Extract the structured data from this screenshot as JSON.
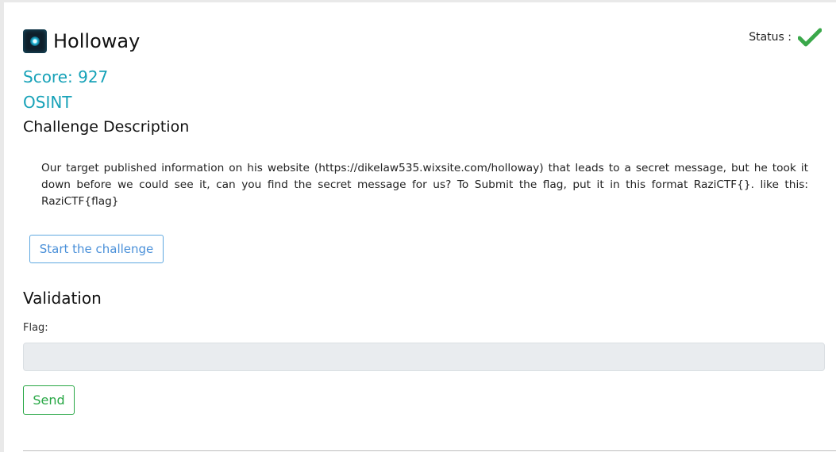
{
  "challenge": {
    "title": "Holloway",
    "logo_icon": "cyber-eye-icon",
    "status_label": "Status :",
    "status_icon": "checkmark-icon",
    "status_color": "#28a745",
    "score": "Score: 927",
    "category": "OSINT",
    "description_heading": "Challenge Description",
    "description": "Our target published information on his website (https://dikelaw535.wixsite.com/holloway) that leads to a secret message, but he took it down before we could see it, can you find the secret message for us?  To Submit the flag, put it in this format RaziCTF{}. like this: RaziCTF{flag}",
    "start_button": "Start the challenge"
  },
  "validation": {
    "heading": "Validation",
    "flag_label": "Flag:",
    "flag_value": "",
    "send_button": "Send"
  },
  "colors": {
    "accent": "#17a2b8",
    "primary_outline": "#4a90d9",
    "success": "#28a745"
  }
}
